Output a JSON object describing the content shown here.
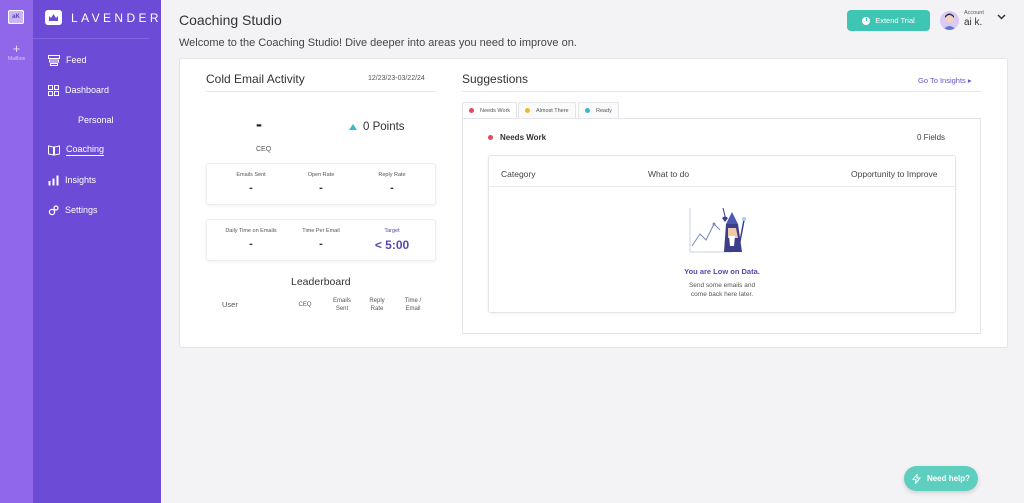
{
  "rail": {
    "workspace_initials": "aK",
    "add_label": "Mailbox"
  },
  "brand": {
    "name": "LAVENDER"
  },
  "nav": [
    {
      "label": "Feed",
      "icon": "feed-icon"
    },
    {
      "label": "Dashboard",
      "icon": "dashboard-icon"
    },
    {
      "label": "Personal"
    },
    {
      "label": "Coaching",
      "icon": "coaching-icon",
      "active": true
    },
    {
      "label": "Insights",
      "icon": "insights-icon"
    },
    {
      "label": "Settings",
      "icon": "settings-icon"
    }
  ],
  "header": {
    "title": "Coaching Studio",
    "subtitle": "Welcome to the Coaching Studio! Dive deeper into areas you need to improve on.",
    "extend_trial": "Extend Trial",
    "account_label": "Account",
    "account_name": "ai k."
  },
  "activity": {
    "title": "Cold Email Activity",
    "date_range": "12/23/23-03/22/24",
    "ceq_value": "-",
    "ceq_label": "CEQ",
    "points": "0 Points",
    "stats_row1": [
      {
        "label": "Emails Sent",
        "value": "-"
      },
      {
        "label": "Open Rate",
        "value": "-"
      },
      {
        "label": "Reply Rate",
        "value": "-"
      }
    ],
    "stats_row2": [
      {
        "label": "Daily Time on Emails",
        "value": "-"
      },
      {
        "label": "Time Per Email",
        "value": "-"
      },
      {
        "label": "Target",
        "value": "< 5:00"
      }
    ]
  },
  "leaderboard": {
    "title": "Leaderboard",
    "columns": [
      "User",
      "CEQ",
      "Emails Sent",
      "Reply Rate",
      "Time / Email"
    ]
  },
  "suggestions": {
    "title": "Suggestions",
    "goto_link": "Go To Insights ▸",
    "tabs": [
      {
        "label": "Needs Work",
        "color": "#e5485d"
      },
      {
        "label": "Almost There",
        "color": "#f0b92c"
      },
      {
        "label": "Ready",
        "color": "#3bb8d0"
      }
    ],
    "section_label": "Needs Work",
    "section_color": "#e5485d",
    "fields_count": "0 Fields",
    "table_headers": [
      "Category",
      "What to do",
      "Opportunity to Improve"
    ],
    "empty_title": "You are Low on Data.",
    "empty_line1": "Send some emails and",
    "empty_line2": "come back here later."
  },
  "help": {
    "label": "Need help?"
  }
}
